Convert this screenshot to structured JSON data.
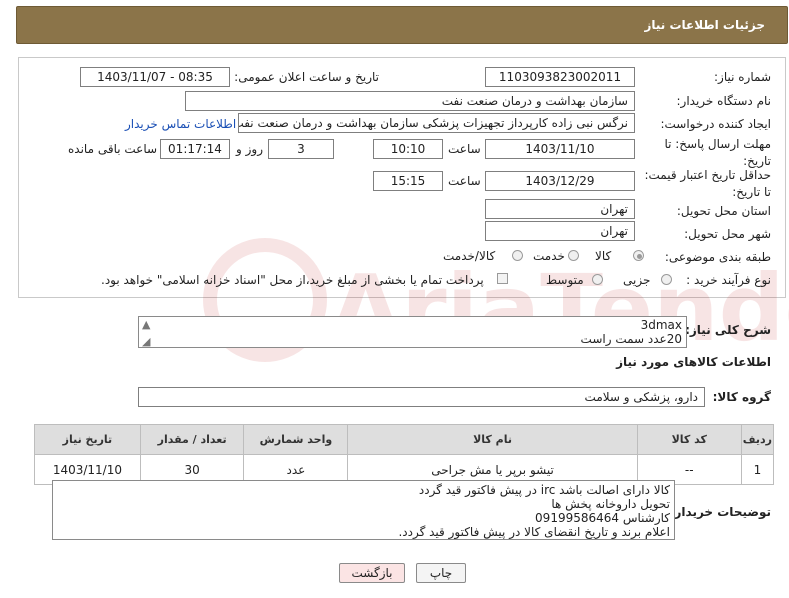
{
  "header": {
    "title": "جزئیات اطلاعات نیاز"
  },
  "form": {
    "need_number": {
      "label": "شماره نیاز:",
      "value": "1103093823002011"
    },
    "announce_datetime": {
      "label": "تاریخ و ساعت اعلان عمومی:",
      "value": "1403/11/07 - 08:35"
    },
    "buyer_org": {
      "label": "نام دستگاه خریدار:",
      "value": "سازمان بهداشت و درمان صنعت نفت"
    },
    "requester": {
      "label": "ایجاد کننده درخواست:",
      "value": "نرگس نبی زاده کارپرداز تجهیزات پزشکی سازمان بهداشت و درمان صنعت نفت",
      "contact_link": "اطلاعات تماس خریدار"
    },
    "reply_deadline": {
      "label": "مهلت ارسال پاسخ: تا تاریخ:",
      "date": "1403/11/10",
      "time_label": "ساعت",
      "time": "10:10",
      "days": "3",
      "days_label": "روز و",
      "remaining": "01:17:14",
      "remaining_label": "ساعت باقی مانده"
    },
    "price_validity": {
      "label": "حداقل تاریخ اعتبار قیمت: تا تاریخ:",
      "date": "1403/12/29",
      "time_label": "ساعت",
      "time": "15:15"
    },
    "province": {
      "label": "استان محل تحویل:",
      "value": "تهران"
    },
    "city": {
      "label": "شهر محل تحویل:",
      "value": "تهران"
    },
    "category": {
      "label": "طبقه بندی موضوعی:",
      "options": [
        "کالا",
        "خدمت",
        "کالا/خدمت"
      ],
      "selected": "کالا"
    },
    "purchase_type": {
      "label": "نوع فرآیند خرید :",
      "options": [
        "جزیی",
        "متوسط"
      ],
      "treasury_note": "پرداخت تمام یا بخشی از مبلغ خرید،از محل \"اسناد خزانه اسلامی\" خواهد بود."
    }
  },
  "description": {
    "label": "شرح کلی نیاز:",
    "text_line1": "3dmax",
    "text_line2": "20عدد سمت راست"
  },
  "goods_info": {
    "title": "اطلاعات کالاهای مورد نیاز"
  },
  "goods_group": {
    "label": "گروه کالا:",
    "value": "دارو، پزشکی و سلامت"
  },
  "table": {
    "headers": [
      "ردیف",
      "کد کالا",
      "نام کالا",
      "واحد شمارش",
      "تعداد / مقدار",
      "تاریخ نیاز"
    ],
    "rows": [
      {
        "row": "1",
        "code": "--",
        "name": "تیشو برپر یا مش جراحی",
        "unit": "عدد",
        "qty": "30",
        "date": "1403/11/10"
      }
    ]
  },
  "buyer_notes": {
    "label": "توضیحات خریدار:",
    "lines": [
      "کالا دارای اصالت باشد irc در پیش فاکتور قید گردد",
      "تحویل داروخانه پخش ها",
      "کارشناس 09199586464",
      "اعلام برند و تاریخ انقضای کالا در پیش فاکتور قید گردد."
    ]
  },
  "buttons": {
    "print": "چاپ",
    "back": "بازگشت"
  },
  "watermark": {
    "text": "AriaTender.neT"
  },
  "colors": {
    "header_bg": "#8b7449",
    "link": "#1a4fb5",
    "back_button": "#fbe4e4"
  }
}
